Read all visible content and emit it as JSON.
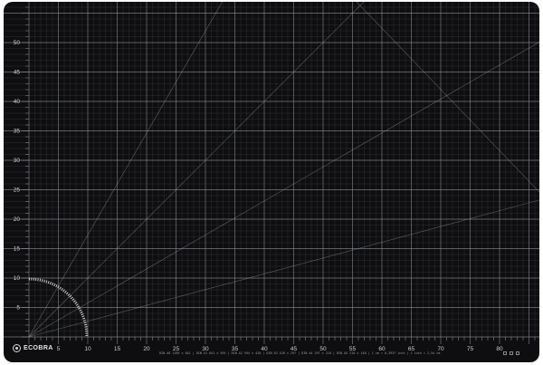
{
  "brand": {
    "name": "ECOBRA",
    "logo_icon": "ecobra-logo-icon"
  },
  "mat": {
    "background_color": "#0e0e10",
    "grid_color": "#9aa0a6",
    "unit": "cm",
    "major_every": 5,
    "horizontal_scale_max": 88,
    "vertical_scale_max": 58,
    "vertical_labels": [
      "5",
      "10",
      "15",
      "20",
      "25",
      "30",
      "35",
      "40",
      "45",
      "50"
    ],
    "horizontal_labels": [
      "5",
      "10",
      "15",
      "20",
      "25",
      "30",
      "35",
      "40",
      "45",
      "50",
      "55",
      "60",
      "65",
      "70",
      "75",
      "80"
    ],
    "angle_lines_degrees": [
      15,
      30,
      45,
      60
    ],
    "protractor_icon": "protractor-icon"
  },
  "footer": {
    "size_reference": "DIN A0 1189 x 841 | DIN A1 841 x 594 | DIN A2 594 x 420 | DIN A3 420 x 297 | DIN A4 297 x 210 | DIN A5 210 x 148 | 1 cm = 0,3937 inch | 1 inch = 2,54 cm",
    "icons": [
      "cut-icon",
      "heal-icon",
      "both-sides-icon"
    ]
  }
}
